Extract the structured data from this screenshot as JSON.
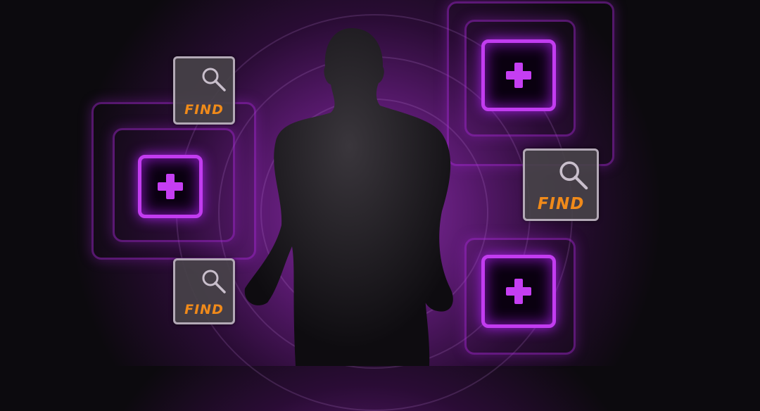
{
  "colors": {
    "accent": "#c23cf0",
    "find_text": "#f08a1a",
    "find_border": "#b3a9b6"
  },
  "find_slots": [
    {
      "label": "FIND",
      "icon": "magnifier-icon"
    },
    {
      "label": "FIND",
      "icon": "magnifier-icon"
    },
    {
      "label": "FIND",
      "icon": "magnifier-icon"
    }
  ],
  "add_slots": [
    {
      "icon": "plus-icon"
    },
    {
      "icon": "plus-icon"
    },
    {
      "icon": "plus-icon"
    }
  ]
}
